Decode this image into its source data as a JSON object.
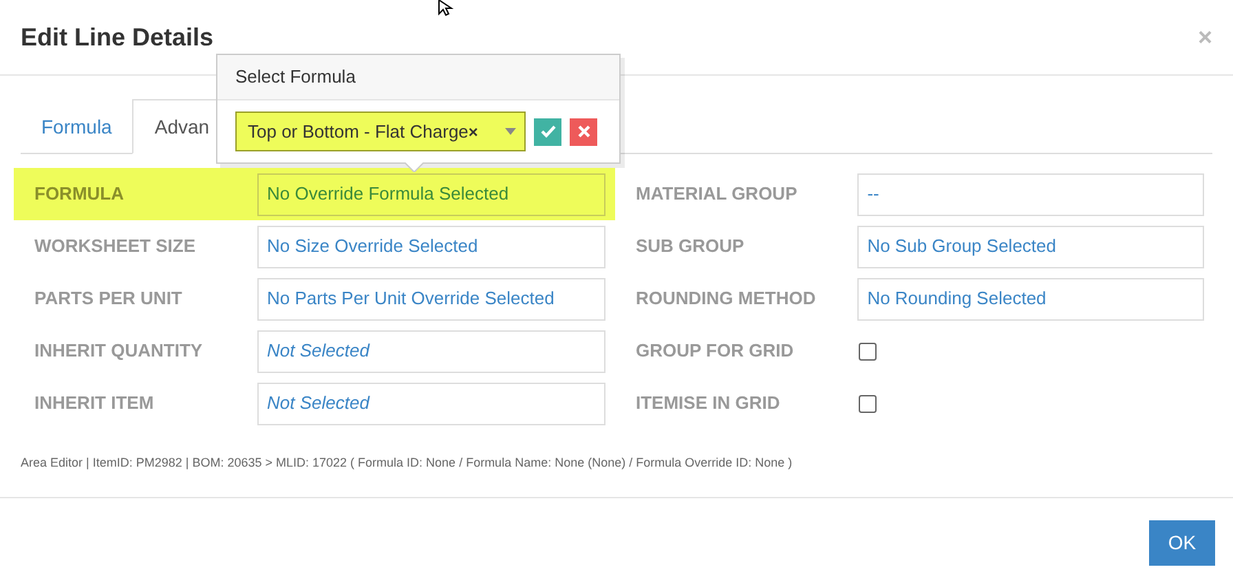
{
  "dialog": {
    "title": "Edit Line Details",
    "close": "×"
  },
  "tabs": [
    {
      "label": "Formula",
      "selected": false
    },
    {
      "label": "Advan",
      "selected": true
    }
  ],
  "popover": {
    "title": "Select Formula",
    "select": {
      "value": "Top or Bottom - Flat Charge",
      "clear": "×",
      "highlighted": true
    }
  },
  "rows": [
    {
      "fields": [
        {
          "label": "FORMULA",
          "kind": "select",
          "value": "No Override Formula Selected",
          "italic": false,
          "highlighted": true
        },
        {
          "label": "MATERIAL GROUP",
          "kind": "select",
          "value": "--",
          "italic": false,
          "highlighted": false
        }
      ]
    },
    {
      "fields": [
        {
          "label": "WORKSHEET SIZE",
          "kind": "select",
          "value": "No Size Override Selected",
          "italic": false,
          "highlighted": false
        },
        {
          "label": "SUB GROUP",
          "kind": "select",
          "value": "No Sub Group Selected",
          "italic": false,
          "highlighted": false
        }
      ]
    },
    {
      "fields": [
        {
          "label": "PARTS PER UNIT",
          "kind": "select",
          "value": "No Parts Per Unit Override Selected",
          "italic": false,
          "highlighted": false
        },
        {
          "label": "ROUNDING METHOD",
          "kind": "select",
          "value": "No Rounding Selected",
          "italic": false,
          "highlighted": false
        }
      ]
    },
    {
      "fields": [
        {
          "label": "INHERIT QUANTITY",
          "kind": "select",
          "value": "Not Selected",
          "italic": true,
          "highlighted": false
        },
        {
          "label": "GROUP FOR GRID",
          "kind": "checkbox",
          "checked": false,
          "highlighted": false
        }
      ]
    },
    {
      "fields": [
        {
          "label": "INHERIT ITEM",
          "kind": "select",
          "value": "Not Selected",
          "italic": true,
          "highlighted": false
        },
        {
          "label": "ITEMISE IN GRID",
          "kind": "checkbox",
          "checked": false,
          "highlighted": false
        }
      ]
    }
  ],
  "info": "Area Editor | ItemID: PM2982 | BOM: 20635 > MLID: 17022 ( Formula ID: None / Formula Name: None (None) / Formula Override ID: None )",
  "ok_button": "OK"
}
